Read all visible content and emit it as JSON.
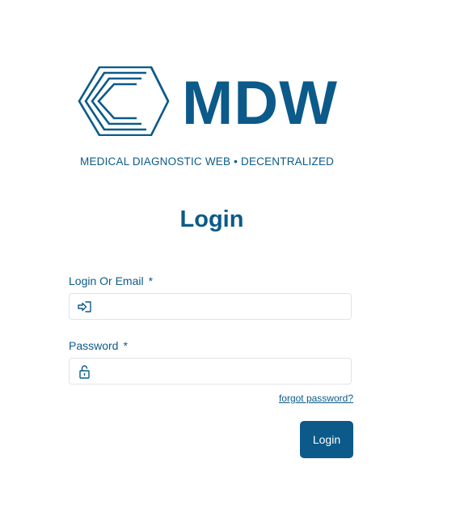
{
  "logo": {
    "wordmark": "MDW",
    "tagline": "MEDICAL DIAGNOSTIC WEB • DECENTRALIZED",
    "icon": "hexagon-logo-icon"
  },
  "page": {
    "title": "Login"
  },
  "form": {
    "login": {
      "label": "Login Or Email",
      "required_marker": "*",
      "value": "",
      "placeholder": "",
      "icon": "sign-in-icon"
    },
    "password": {
      "label": "Password",
      "required_marker": "*",
      "value": "",
      "placeholder": "",
      "icon": "lock-open-icon"
    },
    "forgot_label": "forgot password?",
    "submit_label": "Login"
  },
  "colors": {
    "brand": "#0b5a8a",
    "border": "#dfe3e8",
    "background": "#ffffff"
  }
}
